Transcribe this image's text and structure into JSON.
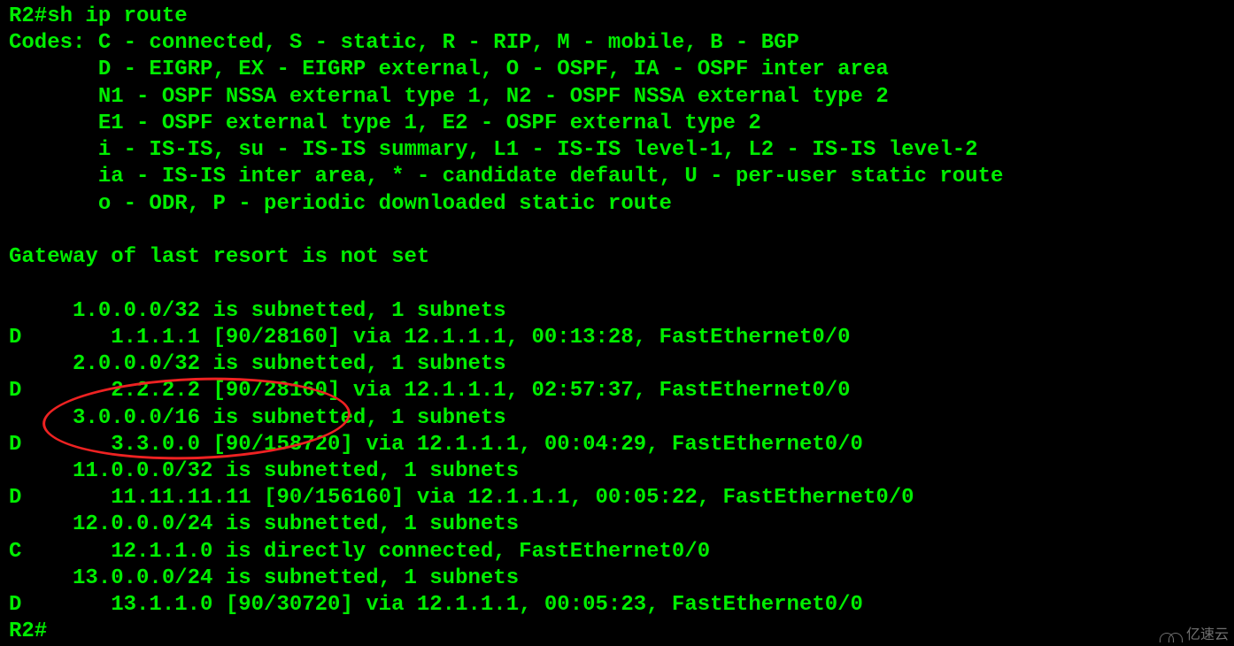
{
  "terminal": {
    "prompt_cmd": "R2#sh ip route",
    "codes_header": "Codes: C - connected, S - static, R - RIP, M - mobile, B - BGP",
    "codes_line2": "       D - EIGRP, EX - EIGRP external, O - OSPF, IA - OSPF inter area ",
    "codes_line3": "       N1 - OSPF NSSA external type 1, N2 - OSPF NSSA external type 2",
    "codes_line4": "       E1 - OSPF external type 1, E2 - OSPF external type 2",
    "codes_line5": "       i - IS-IS, su - IS-IS summary, L1 - IS-IS level-1, L2 - IS-IS level-2",
    "codes_line6": "       ia - IS-IS inter area, * - candidate default, U - per-user static route",
    "codes_line7": "       o - ODR, P - periodic downloaded static route",
    "blank": " ",
    "gateway": "Gateway of last resort is not set",
    "route1_header": "     1.0.0.0/32 is subnetted, 1 subnets",
    "route1_entry": "D       1.1.1.1 [90/28160] via 12.1.1.1, 00:13:28, FastEthernet0/0",
    "route2_header": "     2.0.0.0/32 is subnetted, 1 subnets",
    "route2_entry": "D       2.2.2.2 [90/28160] via 12.1.1.1, 02:57:37, FastEthernet0/0",
    "route3_header": "     3.0.0.0/16 is subnetted, 1 subnets",
    "route3_entry": "D       3.3.0.0 [90/158720] via 12.1.1.1, 00:04:29, FastEthernet0/0",
    "route4_header": "     11.0.0.0/32 is subnetted, 1 subnets",
    "route4_entry": "D       11.11.11.11 [90/156160] via 12.1.1.1, 00:05:22, FastEthernet0/0",
    "route5_header": "     12.0.0.0/24 is subnetted, 1 subnets",
    "route5_entry": "C       12.1.1.0 is directly connected, FastEthernet0/0",
    "route6_header": "     13.0.0.0/24 is subnetted, 1 subnets",
    "route6_entry": "D       13.1.1.0 [90/30720] via 12.1.1.1, 00:05:23, FastEthernet0/0",
    "prompt_end": "R2#"
  },
  "annotation": {
    "ellipse_target": "3.0.0.0/16 subnet route"
  },
  "watermark": {
    "text": "亿速云"
  }
}
